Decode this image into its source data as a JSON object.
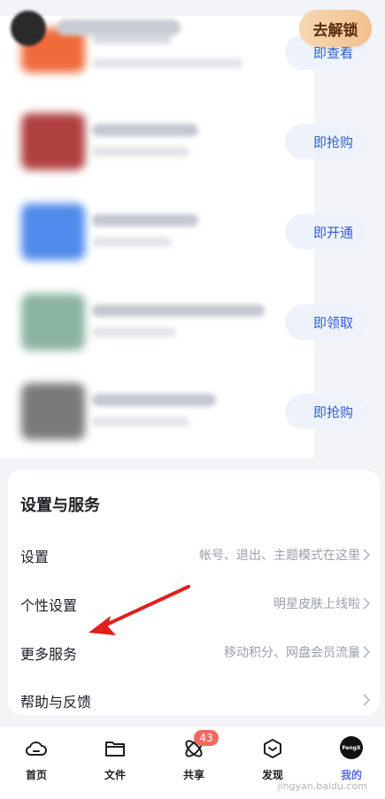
{
  "header": {
    "unlock_label": "去解锁"
  },
  "promos": [
    {
      "button": "即查看",
      "thumb_color": "#f06a3a"
    },
    {
      "button": "即抢购",
      "thumb_color": "#b04040"
    },
    {
      "button": "即开通",
      "thumb_color": "#4f8bea"
    },
    {
      "button": "即领取",
      "thumb_color": "#8bb4a0"
    },
    {
      "button": "即抢购",
      "thumb_color": "#7a7a7a"
    }
  ],
  "settings": {
    "title": "设置与服务",
    "rows": [
      {
        "label": "设置",
        "desc": "帐号、退出、主题模式在这里"
      },
      {
        "label": "个性设置",
        "desc": "明星皮肤上线啦"
      },
      {
        "label": "更多服务",
        "desc": "移动积分、网盘会员流量"
      },
      {
        "label": "帮助与反馈",
        "desc": ""
      }
    ]
  },
  "nav": {
    "items": [
      {
        "label": "首页",
        "icon": "cloud-icon"
      },
      {
        "label": "文件",
        "icon": "folder-icon"
      },
      {
        "label": "共享",
        "icon": "share-orbit-icon",
        "badge": "43"
      },
      {
        "label": "发现",
        "icon": "discover-icon"
      },
      {
        "label": "我的",
        "icon": "avatar-icon",
        "avatar_text": "FengX"
      }
    ]
  },
  "watermark": "jingyan.baidu.com",
  "colors": {
    "accent_blue": "#2f5fd6",
    "arrow_red": "#e0201c",
    "badge_red": "#f06a5e"
  }
}
